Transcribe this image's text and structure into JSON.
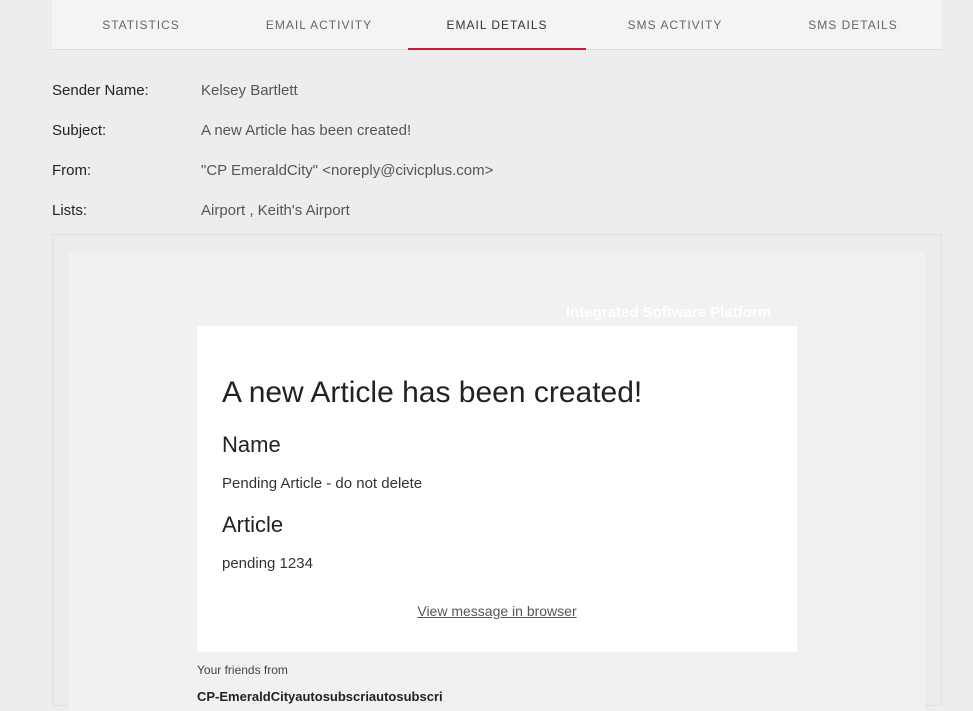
{
  "tabs": [
    {
      "label": "STATISTICS"
    },
    {
      "label": "EMAIL ACTIVITY"
    },
    {
      "label": "EMAIL DETAILS"
    },
    {
      "label": "SMS ACTIVITY"
    },
    {
      "label": "SMS DETAILS"
    }
  ],
  "active_tab": "EMAIL DETAILS",
  "details": {
    "sender_label": "Sender Name:",
    "sender_value": "Kelsey Bartlett",
    "subject_label": "Subject:",
    "subject_value": "A new Article has been created!",
    "from_label": "From:",
    "from_value": "\"CP EmeraldCity\" <noreply@civicplus.com>",
    "lists_label": "Lists:",
    "lists_value": "Airport , Keith's Airport"
  },
  "email": {
    "watermark": "Integrated Software Platform",
    "heading": "A new Article has been created!",
    "name_heading": "Name",
    "name_value": "Pending Article - do not delete",
    "article_heading": "Article",
    "article_value": "pending 1234",
    "view_link": "View message in browser",
    "footer_line1": "Your friends from",
    "footer_line2": "CP-EmeraldCityautosubscriautosubscri"
  },
  "colors": {
    "accent": "#c41e3a",
    "background": "#ededed"
  }
}
